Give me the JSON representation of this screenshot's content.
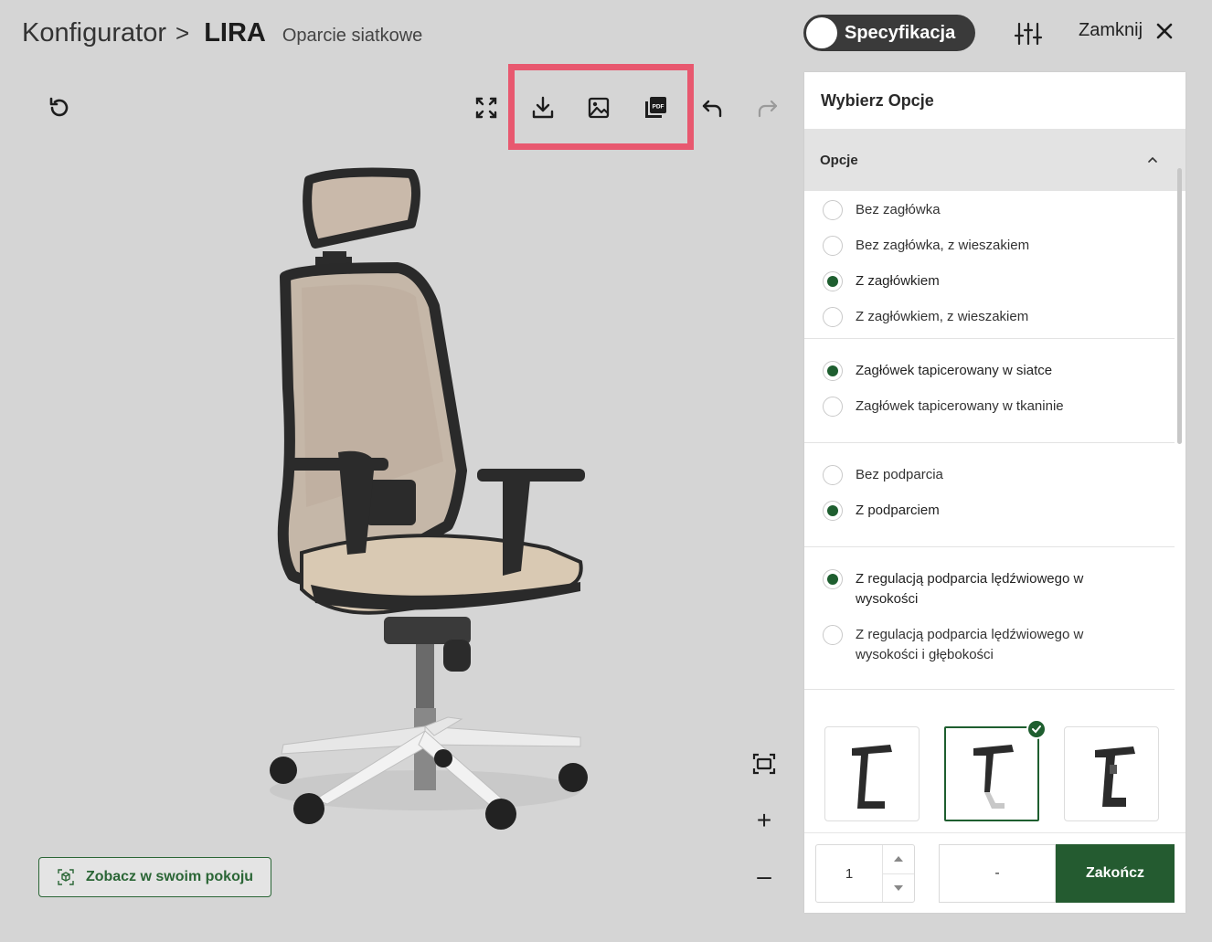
{
  "header": {
    "breadcrumb_root": "Konfigurator",
    "breadcrumb_sep": ">",
    "model": "LIRA",
    "variant": "Oparcie siatkowe",
    "spec_toggle_label": "Specyfikacja",
    "close_label": "Zamknij"
  },
  "toolbar": {
    "icons": [
      "reset-icon",
      "fullscreen-icon",
      "download-icon",
      "image-icon",
      "pdf-icon",
      "undo-icon",
      "redo-icon"
    ],
    "pdf_text": "PDF"
  },
  "viewer": {
    "ar_button_label": "Zobacz w swoim pokoju",
    "zoom_in": "+",
    "zoom_out": "–"
  },
  "panel": {
    "title": "Wybierz Opcje",
    "section_title": "Opcje",
    "groups": [
      {
        "options": [
          {
            "label": "Bez zagłówka",
            "checked": false
          },
          {
            "label": "Bez zagłówka, z wieszakiem",
            "checked": false
          },
          {
            "label": "Z zagłówkiem",
            "checked": true
          },
          {
            "label": "Z zagłówkiem, z wieszakiem",
            "checked": false
          }
        ]
      },
      {
        "options": [
          {
            "label": "Zagłówek tapicerowany w siatce",
            "checked": true
          },
          {
            "label": "Zagłówek tapicerowany w tkaninie",
            "checked": false
          }
        ]
      },
      {
        "options": [
          {
            "label": "Bez podparcia",
            "checked": false
          },
          {
            "label": "Z podparciem",
            "checked": true
          }
        ]
      },
      {
        "options": [
          {
            "label": "Z regulacją podparcia lędźwiowego w wysokości",
            "checked": true
          },
          {
            "label": "Z regulacją podparcia lędźwiowego w wysokości i głębokości",
            "checked": false
          }
        ]
      }
    ],
    "armrest_thumbs_selected_index": 1
  },
  "footer": {
    "quantity": "1",
    "price": "-",
    "finish_label": "Zakończ"
  },
  "colors": {
    "accent_green": "#1e5e2f",
    "highlight": "#e8586f",
    "background": "#d5d5d5"
  }
}
